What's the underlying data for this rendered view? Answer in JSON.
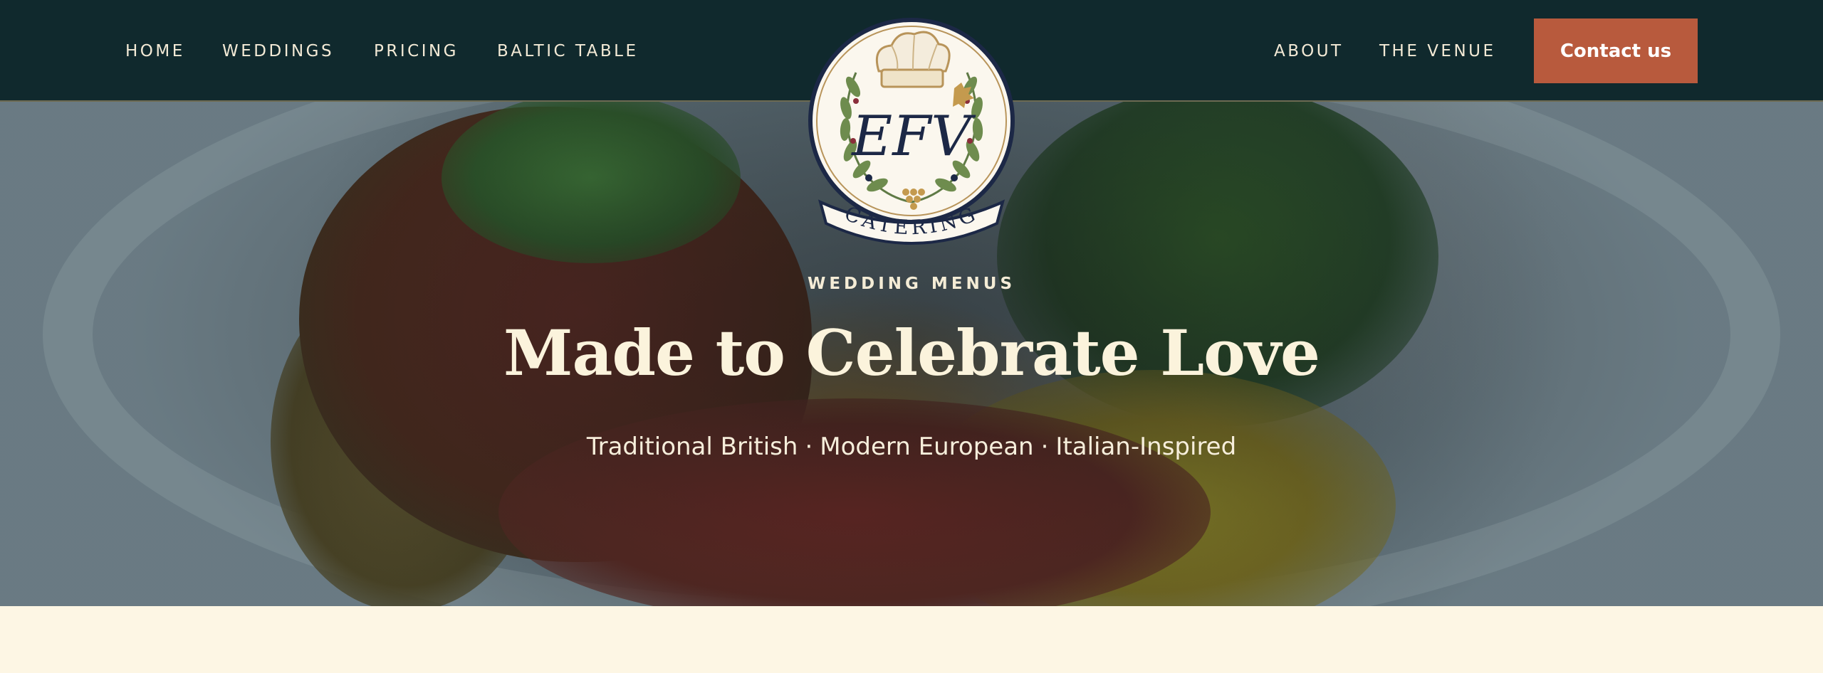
{
  "nav": {
    "left_links": [
      "HOME",
      "WEDDINGS",
      "PRICING",
      "BALTIC TABLE"
    ],
    "right_links": [
      "ABOUT",
      "THE VENUE"
    ],
    "contact_label": "Contact us"
  },
  "logo": {
    "monogram": "EFV",
    "banner_text": "CATERING",
    "icons": [
      "chef-hat-icon",
      "laurel-wreath-icon",
      "grapes-icon",
      "vine-leaf-icon"
    ]
  },
  "hero": {
    "eyebrow": "WEDDING MENUS",
    "headline": "Made to Celebrate Love",
    "tagline_parts": [
      "Traditional British",
      "Modern European",
      "Italian-Inspired"
    ],
    "separator": "·"
  },
  "colors": {
    "navbar_bg": "#10292d",
    "accent_button": "#b85a3d",
    "cream": "#fdf6e4",
    "logo_navy": "#1c2846",
    "logo_gold": "#b8945a",
    "logo_green": "#5f7a45"
  }
}
